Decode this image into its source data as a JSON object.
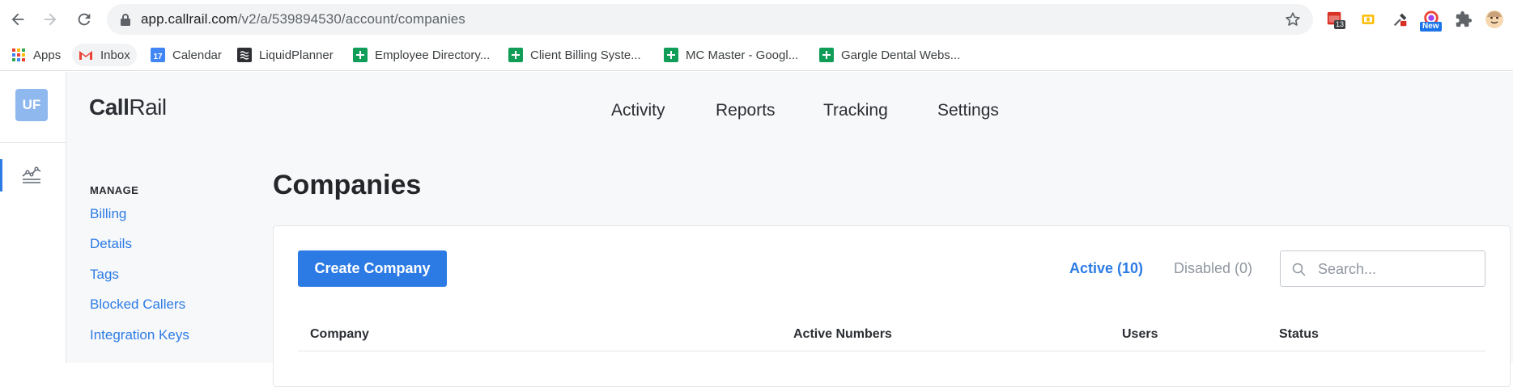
{
  "browser": {
    "url_host": "app.callrail.com",
    "url_path": "/v2/a/539894530/account/companies",
    "extensions": [
      {
        "name": "calendar-ext-icon",
        "badge": "13",
        "badge_color": "#3c4043"
      },
      {
        "name": "coupon-ext-icon",
        "badge": "",
        "badge_color": ""
      },
      {
        "name": "eyedropper-ext-icon",
        "badge": "",
        "badge_color": ""
      },
      {
        "name": "color-ext-icon",
        "badge": "New",
        "badge_color": "#1a73e8"
      },
      {
        "name": "puzzle-icon",
        "badge": "",
        "badge_color": ""
      },
      {
        "name": "profile-avatar-icon",
        "badge": "",
        "badge_color": ""
      }
    ]
  },
  "bookmarks": [
    {
      "label": "Apps",
      "icon": "apps-grid-icon"
    },
    {
      "label": "Inbox",
      "icon": "gmail-icon"
    },
    {
      "label": "Calendar",
      "icon": "calendar-icon",
      "day": "17"
    },
    {
      "label": "LiquidPlanner",
      "icon": "liquidplanner-icon"
    },
    {
      "label": "Employee Directory...",
      "icon": "sheets-icon"
    },
    {
      "label": "Client Billing Syste...",
      "icon": "sheets-icon"
    },
    {
      "label": "MC Master - Googl...",
      "icon": "sheets-icon"
    },
    {
      "label": "Gargle Dental Webs...",
      "icon": "sheets-icon"
    }
  ],
  "rail": {
    "avatar_initials": "UF"
  },
  "logo": {
    "part1": "Call",
    "part2": "Rail"
  },
  "nav": [
    "Activity",
    "Reports",
    "Tracking",
    "Settings"
  ],
  "sidebar": {
    "heading": "MANAGE",
    "links": [
      "Billing",
      "Details",
      "Tags",
      "Blocked Callers",
      "Integration Keys"
    ]
  },
  "page": {
    "title": "Companies"
  },
  "toolbar": {
    "create_label": "Create Company",
    "active_filter": "Active (10)",
    "disabled_filter": "Disabled (0)",
    "search_placeholder": "Search..."
  },
  "table": {
    "columns": [
      "Company",
      "Active Numbers",
      "Users",
      "Status"
    ]
  },
  "colors": {
    "accent": "#2c7be5",
    "avatar": "#8fb9ee"
  }
}
